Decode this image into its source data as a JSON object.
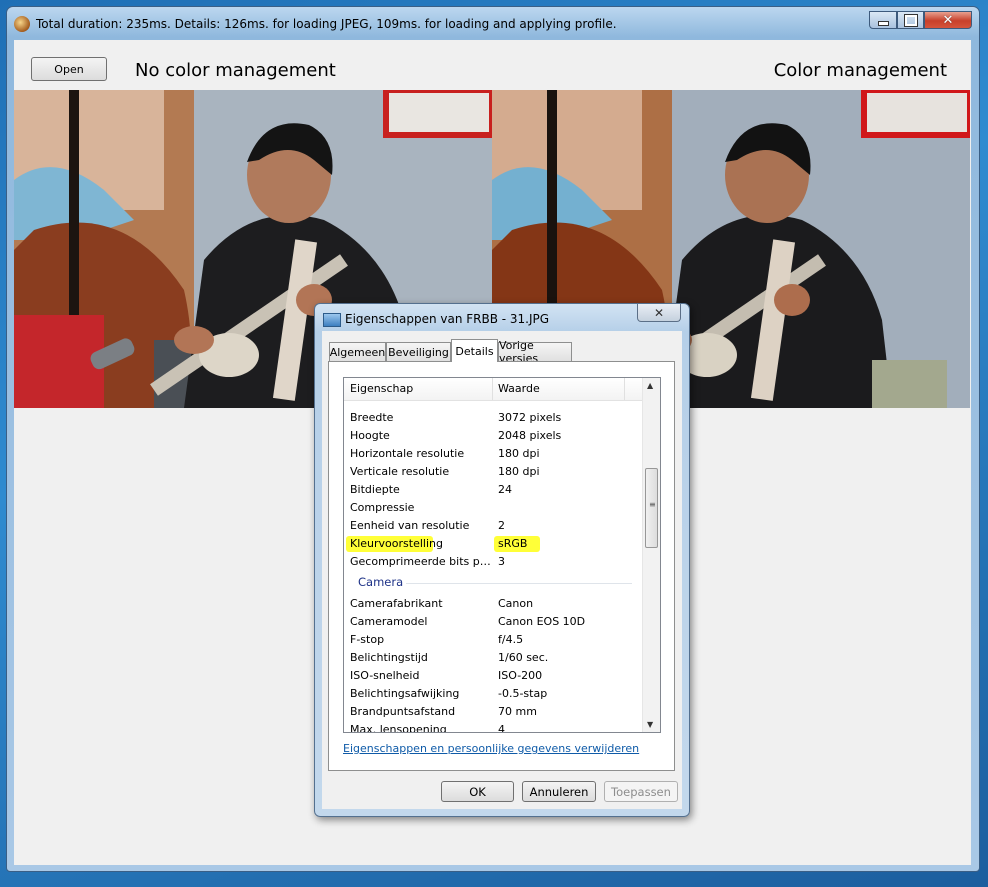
{
  "window": {
    "title": "Total duration: 235ms. Details: 126ms. for loading JPEG, 109ms. for loading and applying profile.",
    "controls": {
      "minimize": "–",
      "maximize": "□",
      "close": "✕"
    }
  },
  "toolbar": {
    "open_label": "Open"
  },
  "labels": {
    "left": "No color management",
    "right": "Color management"
  },
  "dialog": {
    "title": "Eigenschappen van FRBB - 31.JPG",
    "close_glyph": "✕",
    "tabs": [
      "Algemeen",
      "Beveiliging",
      "Details",
      "Vorige versies"
    ],
    "active_tab": "Details",
    "columns": {
      "property": "Eigenschap",
      "value": "Waarde"
    },
    "rows": [
      {
        "k": "Breedte",
        "v": "3072 pixels"
      },
      {
        "k": "Hoogte",
        "v": "2048 pixels"
      },
      {
        "k": "Horizontale resolutie",
        "v": "180 dpi"
      },
      {
        "k": "Verticale resolutie",
        "v": "180 dpi"
      },
      {
        "k": "Bitdiepte",
        "v": "24"
      },
      {
        "k": "Compressie",
        "v": ""
      },
      {
        "k": "Eenheid van resolutie",
        "v": "2"
      },
      {
        "k": "Kleurvoorstelling",
        "v": "sRGB",
        "highlight": true
      },
      {
        "k": "Gecomprimeerde bits per pi...",
        "v": "3"
      }
    ],
    "group": "Camera",
    "camera_rows": [
      {
        "k": "Camerafabrikant",
        "v": "Canon"
      },
      {
        "k": "Cameramodel",
        "v": "Canon EOS 10D"
      },
      {
        "k": "F-stop",
        "v": "f/4.5"
      },
      {
        "k": "Belichtingstijd",
        "v": "1/60 sec."
      },
      {
        "k": "ISO-snelheid",
        "v": "ISO-200"
      },
      {
        "k": "Belichtingsafwijking",
        "v": "-0.5-stap"
      },
      {
        "k": "Brandpuntsafstand",
        "v": "70 mm"
      },
      {
        "k": "Max. lensopening",
        "v": "4"
      }
    ],
    "remove_link": "Eigenschappen en persoonlijke gegevens verwijderen",
    "buttons": {
      "ok": "OK",
      "cancel": "Annuleren",
      "apply": "Toepassen"
    },
    "highlight_color": "#ffff38"
  }
}
